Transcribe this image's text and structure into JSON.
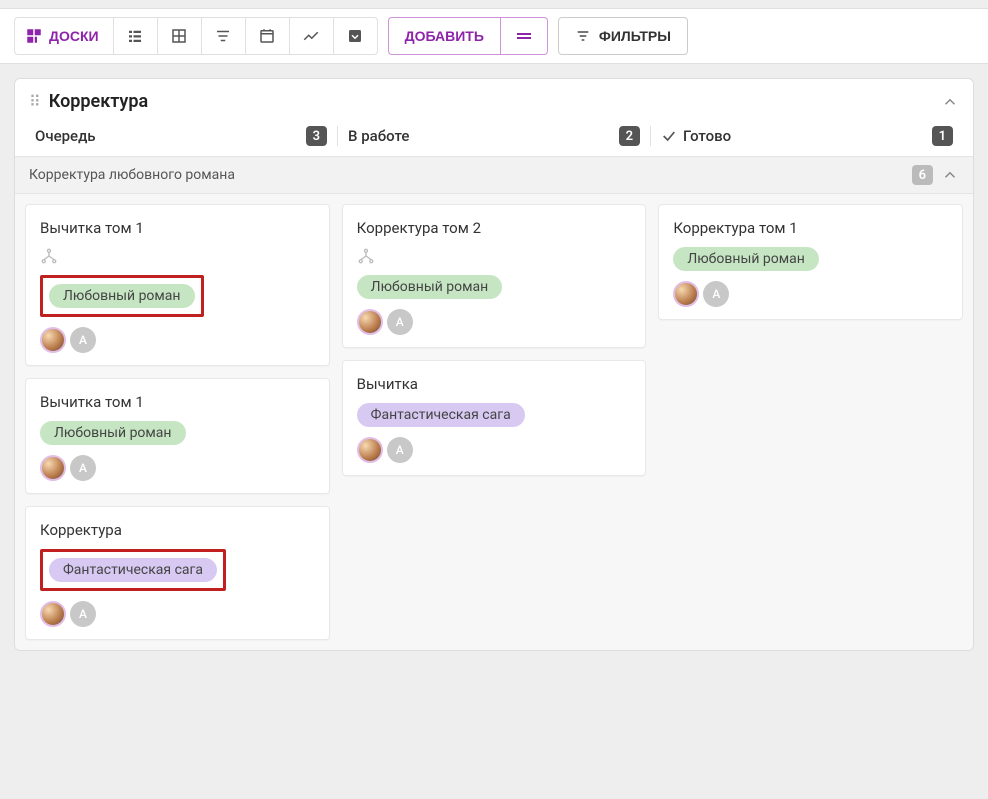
{
  "toolbar": {
    "boards_label": "ДОСКИ",
    "add_label": "ДОБАВИТЬ",
    "filters_label": "ФИЛЬТРЫ"
  },
  "board": {
    "title": "Корректура",
    "columns": [
      {
        "title": "Очередь",
        "count": "3"
      },
      {
        "title": "В работе",
        "count": "2"
      },
      {
        "title": "Готово",
        "count": "1",
        "check": true
      }
    ],
    "group": {
      "title": "Корректура любовного романа",
      "count": "6"
    }
  },
  "cards": {
    "c0": {
      "title": "Вычитка том 1",
      "tag": "Любовный роман",
      "tag_color": "green",
      "tree": true,
      "highlight": true,
      "avatars": [
        "photo",
        "A"
      ]
    },
    "c1": {
      "title": "Вычитка том 1",
      "tag": "Любовный роман",
      "tag_color": "green",
      "avatars": [
        "photo",
        "A"
      ]
    },
    "c2": {
      "title": "Корректура",
      "tag": "Фантастическая сага",
      "tag_color": "purple",
      "highlight": true,
      "avatars": [
        "photo",
        "A"
      ]
    },
    "c3": {
      "title": "Корректура том 2",
      "tag": "Любовный роман",
      "tag_color": "green",
      "tree": true,
      "avatars": [
        "photo",
        "A"
      ]
    },
    "c4": {
      "title": "Вычитка",
      "tag": "Фантастическая сага",
      "tag_color": "purple",
      "avatars": [
        "photo",
        "A"
      ]
    },
    "c5": {
      "title": "Корректура том 1",
      "tag": "Любовный роман",
      "tag_color": "green",
      "avatars": [
        "photo",
        "A"
      ]
    }
  },
  "avatar_letter": "A"
}
